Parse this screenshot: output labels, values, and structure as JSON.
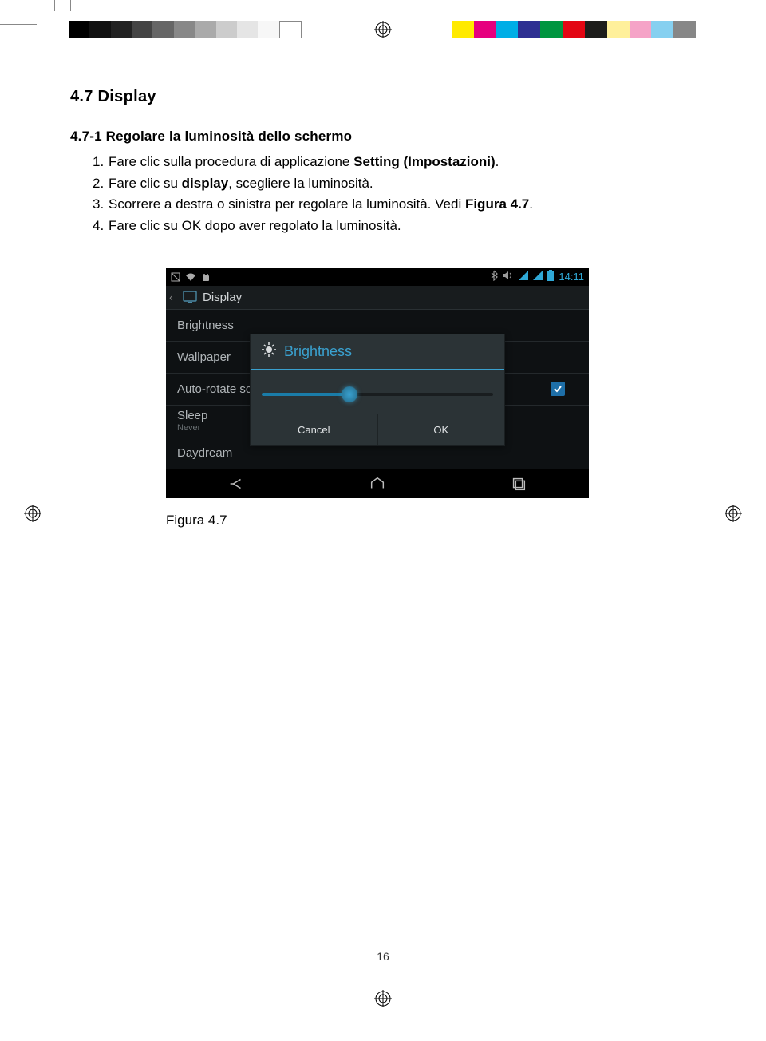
{
  "page_number": "16",
  "section_title": "4.7 Display",
  "subsection_title": "4.7-1 Regolare la luminosità dello schermo",
  "steps": [
    {
      "n": "1.",
      "pre": "Fare clic sulla procedura di applicazione ",
      "bold": "Setting (Impostazioni)",
      "post": "."
    },
    {
      "n": "2.",
      "pre": "Fare clic su ",
      "bold": "display",
      "post": ", scegliere la luminosità."
    },
    {
      "n": "3.",
      "pre": "Scorrere a destra o sinistra per regolare la luminosità. Vedi ",
      "bold": "Figura 4.7",
      "post": "."
    },
    {
      "n": "4.",
      "pre": "Fare clic su OK dopo aver regolato la luminosità.",
      "bold": "",
      "post": ""
    }
  ],
  "screenshot": {
    "statusbar": {
      "time": "14:11"
    },
    "header": {
      "title": "Display"
    },
    "rows": {
      "brightness": "Brightness",
      "wallpaper": "Wallpaper",
      "autorotate": "Auto-rotate sc",
      "sleep": "Sleep",
      "sleep_sub": "Never",
      "daydream": "Daydream"
    },
    "dialog": {
      "title": "Brightness",
      "cancel": "Cancel",
      "ok": "OK"
    }
  },
  "caption": "Figura 4.7"
}
